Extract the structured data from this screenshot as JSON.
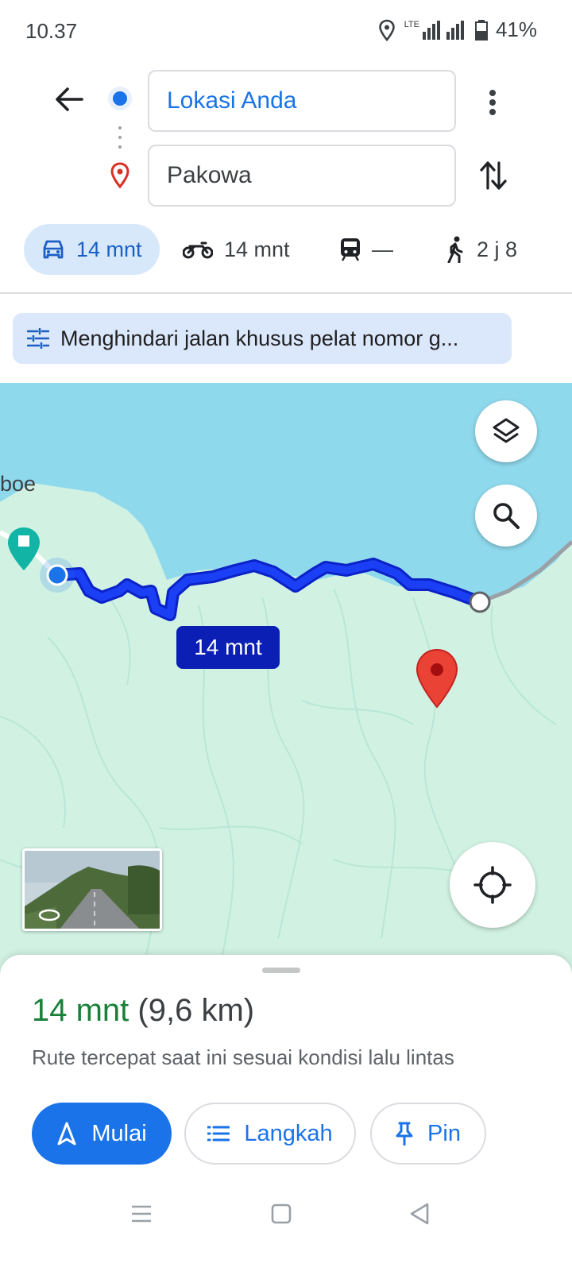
{
  "status_bar": {
    "time": "10.37",
    "network": "LTE",
    "battery": "41%",
    "icons": [
      "location-icon",
      "signal-icon",
      "battery-icon"
    ]
  },
  "search": {
    "origin": "Lokasi Anda",
    "destination": "Pakowa"
  },
  "modes": [
    {
      "icon": "car-icon",
      "label": "14 mnt",
      "active": true
    },
    {
      "icon": "motorcycle-icon",
      "label": "14 mnt",
      "active": false
    },
    {
      "icon": "transit-icon",
      "label": "—",
      "active": false
    },
    {
      "icon": "walk-icon",
      "label": "2 j 8",
      "active": false
    }
  ],
  "options_chip": "Menghindari jalan khusus pelat nomor g...",
  "map": {
    "place_label": "boe",
    "route_badge": "14 mnt",
    "colors": {
      "water": "#8fd9ec",
      "land": "#d1f2e3",
      "route": "#1a3ff5",
      "route_badge": "#0b1fb5",
      "pin": "#ea4335"
    }
  },
  "sheet": {
    "duration": "14 mnt",
    "distance": "(9,6 km)",
    "subtitle": "Rute tercepat saat ini sesuai kondisi lalu lintas",
    "start_label": "Mulai",
    "steps_label": "Langkah",
    "pin_label": "Pin"
  },
  "nav_bar": [
    "menu-icon",
    "home-icon",
    "back-icon"
  ]
}
